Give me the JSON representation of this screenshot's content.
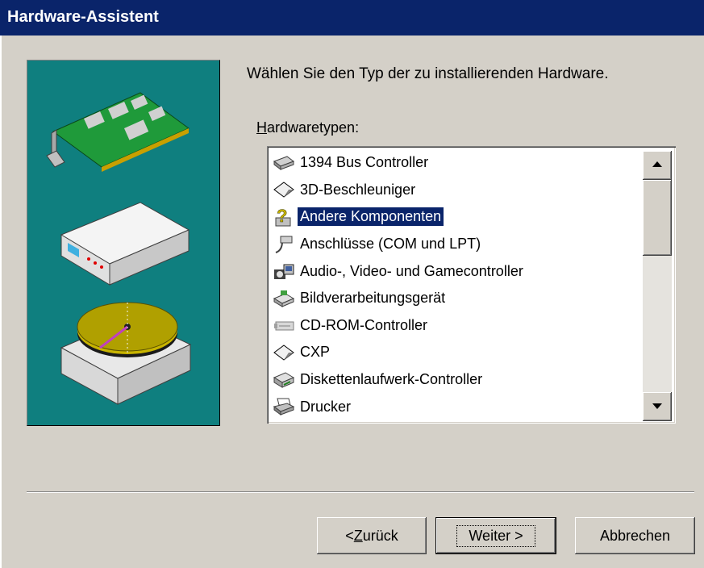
{
  "window": {
    "title": "Hardware-Assistent"
  },
  "main": {
    "prompt": "Wählen Sie den Typ der zu installierenden Hardware.",
    "list_label": {
      "accel": "H",
      "rest": "ardwaretypen:"
    },
    "hardware_types": [
      {
        "label": "1394 Bus Controller",
        "icon": "bus-controller-icon"
      },
      {
        "label": "3D-Beschleuniger",
        "icon": "diamond-icon"
      },
      {
        "label": "Andere Komponenten",
        "icon": "question-device-icon",
        "selected": true
      },
      {
        "label": "Anschlüsse (COM und LPT)",
        "icon": "port-plug-icon"
      },
      {
        "label": "Audio-, Video- und Gamecontroller",
        "icon": "audio-video-icon"
      },
      {
        "label": "Bildverarbeitungsgerät",
        "icon": "scanner-icon"
      },
      {
        "label": "CD-ROM-Controller",
        "icon": "cdrom-controller-icon"
      },
      {
        "label": "CXP",
        "icon": "diamond-icon"
      },
      {
        "label": "Diskettenlaufwerk-Controller",
        "icon": "floppy-controller-icon"
      },
      {
        "label": "Drucker",
        "icon": "printer-icon"
      }
    ]
  },
  "buttons": {
    "back": {
      "prefix": "< ",
      "accel": "Z",
      "rest": "urück"
    },
    "next": "Weiter >",
    "cancel": "Abbrechen"
  },
  "colors": {
    "title_bar": "#0a246a",
    "side_panel": "#0f7f7f",
    "selection": "#0a246a",
    "face": "#d4d0c8"
  }
}
